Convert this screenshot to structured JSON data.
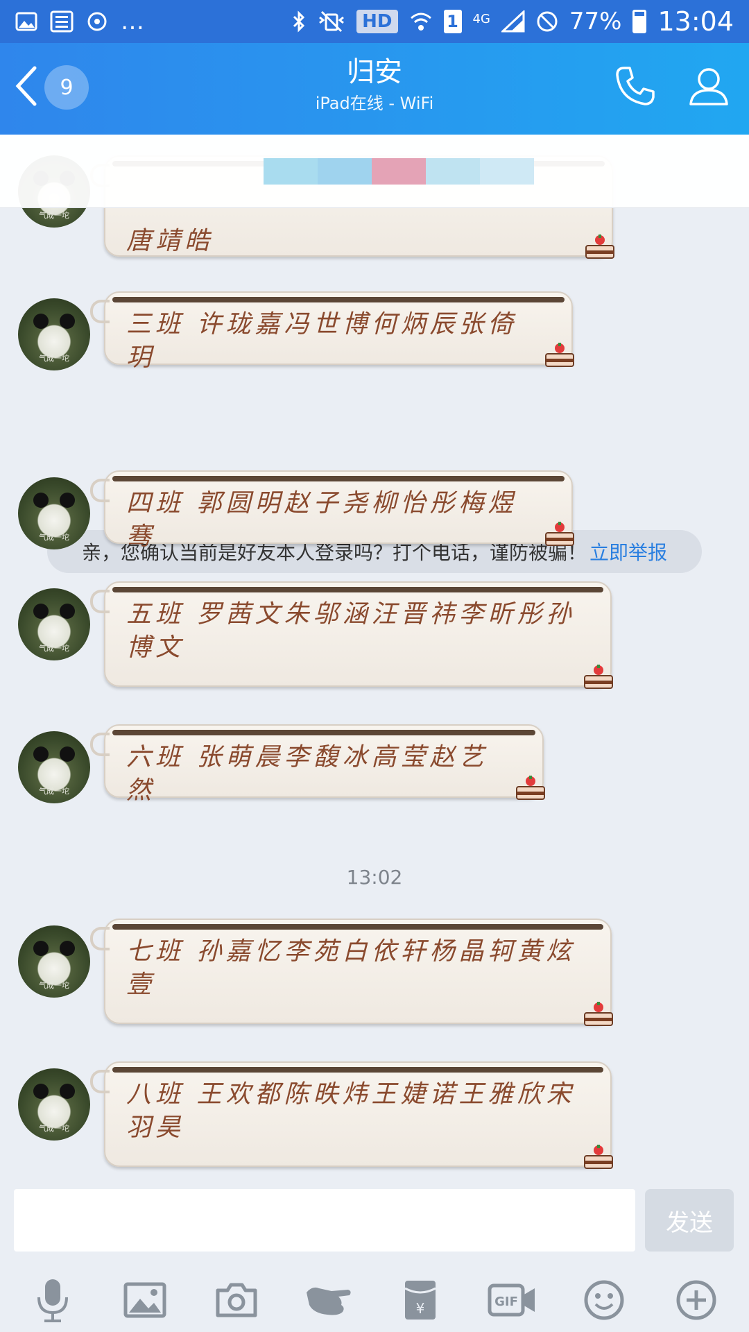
{
  "status_bar": {
    "hd": "HD",
    "sim": "1",
    "network": "4G",
    "battery": "77%",
    "battery_level": 0.77,
    "time": "13:04"
  },
  "header": {
    "unread_count": "9",
    "title": "归安",
    "subtitle": "iPad在线 - WiFi"
  },
  "avatar_caption": "气成一坨",
  "messages": [
    {
      "text": "唐靖皓"
    },
    {
      "text": "三班 许珑嘉冯世博何炳辰张倚玥"
    },
    {
      "text": "四班 郭圆明赵子尧柳怡彤梅煜骞"
    },
    {
      "text": "五班 罗茜文朱邬涵汪晋祎李昕彤孙博文"
    },
    {
      "text": "六班 张萌晨李馥冰高莹赵艺然"
    },
    {
      "text": "七班 孙嘉忆李苑白依轩杨晶轲黄炫壹"
    },
    {
      "text": "八班 王欢都陈昳炜王婕诺王雅欣宋羽昊"
    }
  ],
  "notice": {
    "text": "亲，您确认当前是好友本人登录吗？打个电话，谨防被骗！",
    "link": "立即举报"
  },
  "timestamp": "13:02",
  "input": {
    "placeholder": "",
    "send_label": "发送"
  },
  "toolbar_icons": [
    "mic-icon",
    "image-icon",
    "camera-icon",
    "poke-icon",
    "red-packet-icon",
    "gif-icon",
    "emoji-icon",
    "plus-icon"
  ],
  "colors": {
    "header_start": "#2f86ec",
    "header_end": "#21a7f1",
    "bubble_text": "#8a4a2e",
    "link": "#2a7fe0"
  }
}
